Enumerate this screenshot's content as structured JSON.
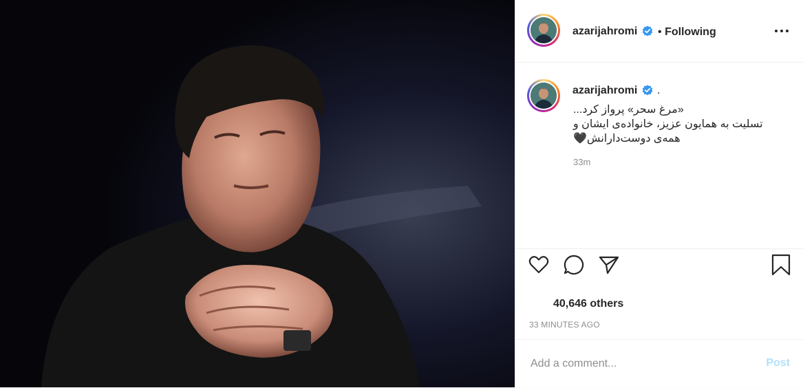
{
  "header": {
    "username": "azarijahromi",
    "separator": "•",
    "follow_status": "Following",
    "verified_icon": "verified-badge-icon",
    "more_icon": "more-options-icon"
  },
  "caption": {
    "username": "azarijahromi",
    "trailing": ".",
    "lines": [
      "«مرغ سحر» پرواز کرد...",
      "تسلیت به همایون عزیز، خانواده‌ی ایشان و",
      "همه‌ی دوست‌دارانش🖤"
    ],
    "time": "33m"
  },
  "actions": {
    "like_icon": "heart-icon",
    "comment_icon": "comment-icon",
    "share_icon": "share-icon",
    "save_icon": "bookmark-icon"
  },
  "likes_text": "40,646 others",
  "posted_ago": "33 MINUTES AGO",
  "comment": {
    "placeholder": "Add a comment...",
    "post_label": "Post"
  },
  "colors": {
    "verified_blue": "#3897f0",
    "post_button_disabled": "#b2dffc",
    "muted_text": "#8e8e8e",
    "divider": "#efefef"
  }
}
